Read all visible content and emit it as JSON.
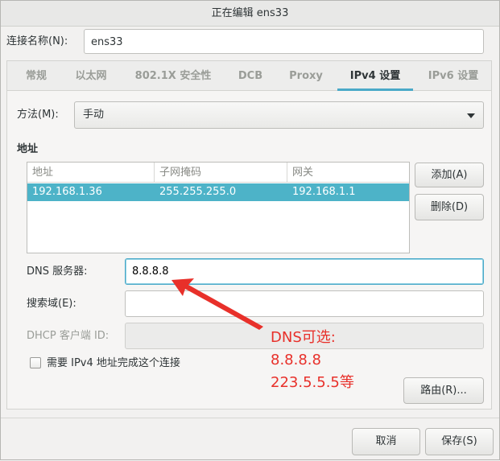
{
  "window": {
    "title": "正在编辑 ens33"
  },
  "connection": {
    "label": "连接名称(N):",
    "value": "ens33"
  },
  "tabs": [
    {
      "label": "常规",
      "active": false
    },
    {
      "label": "以太网",
      "active": false
    },
    {
      "label": "802.1X 安全性",
      "active": false
    },
    {
      "label": "DCB",
      "active": false
    },
    {
      "label": "Proxy",
      "active": false
    },
    {
      "label": "IPv4 设置",
      "active": true
    },
    {
      "label": "IPv6 设置",
      "active": false
    }
  ],
  "method": {
    "label": "方法(M):",
    "value": "手动"
  },
  "addresses": {
    "section_title": "地址",
    "columns": [
      "地址",
      "子网掩码",
      "网关"
    ],
    "rows": [
      {
        "address": "192.168.1.36",
        "netmask": "255.255.255.0",
        "gateway": "192.168.1.1"
      }
    ],
    "add_label": "添加(A)",
    "delete_label": "删除(D)"
  },
  "dns": {
    "label": "DNS 服务器:",
    "value": "8.8.8.8"
  },
  "search_domain": {
    "label": "搜索域(E):",
    "value": ""
  },
  "dhcp_client_id": {
    "label": "DHCP 客户端 ID:",
    "value": ""
  },
  "require_ipv4": {
    "label": "需要 IPv4 地址完成这个连接",
    "checked": false
  },
  "routes_label": "路由(R)...",
  "annotation": {
    "lines": [
      "DNS可选:",
      "8.8.8.8",
      "223.5.5.5等"
    ],
    "color": "#e8302a"
  },
  "footer": {
    "cancel_label": "取消",
    "save_label": "保存(S)"
  },
  "colors": {
    "accent": "#4aa9c8",
    "selection": "#4db3c8",
    "annotation": "#e8302a"
  }
}
